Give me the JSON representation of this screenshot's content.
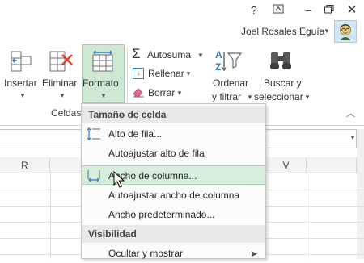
{
  "window": {
    "help": "?",
    "ribbon_display": "⊼",
    "minimize": "–",
    "restore": "❐",
    "close": "✕",
    "user_name": "Joel Rosales Eguía"
  },
  "ribbon": {
    "insertar": "Insertar",
    "eliminar": "Eliminar",
    "formato": "Formato",
    "celdas_group": "Celdas",
    "autosuma": "Autosuma",
    "rellenar": "Rellenar",
    "borrar": "Borrar",
    "ordenar_1": "Ordenar",
    "ordenar_2": "y filtrar",
    "buscar_1": "Buscar y",
    "buscar_2": "seleccionar"
  },
  "columns": {
    "r": "R",
    "v": "V"
  },
  "menu": {
    "section_size": "Tamaño de celda",
    "alto_fila": "Alto de fila...",
    "autoajustar_alto": "Autoajustar alto de fila",
    "ancho_columna": "Ancho de columna...",
    "autoajustar_ancho": "Autoajustar ancho de columna",
    "ancho_predeterminado": "Ancho predeterminado...",
    "section_visibility": "Visibilidad",
    "ocultar_mostrar": "Ocultar y mostrar"
  },
  "colors": {
    "accent_green": "#217346",
    "highlight": "#d8eedc",
    "active_button": "#cfe8d4"
  }
}
